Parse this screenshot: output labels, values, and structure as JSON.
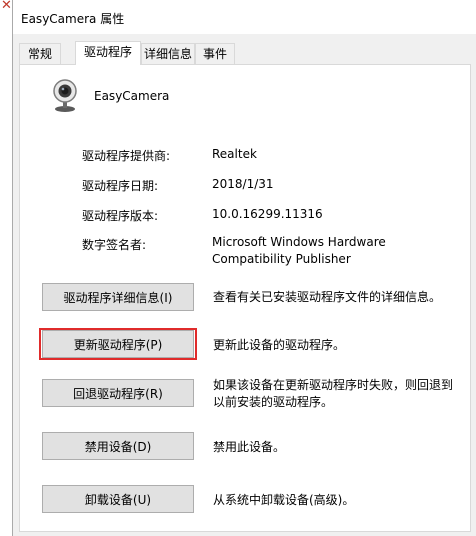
{
  "window": {
    "title": "EasyCamera 属性"
  },
  "tabs": [
    {
      "label": "常规"
    },
    {
      "label": "驱动程序"
    },
    {
      "label": "详细信息"
    },
    {
      "label": "事件"
    }
  ],
  "device": {
    "name": "EasyCamera",
    "icon": "webcam-icon"
  },
  "properties": {
    "provider_label": "驱动程序提供商:",
    "provider_value": "Realtek",
    "date_label": "驱动程序日期:",
    "date_value": "2018/1/31",
    "version_label": "驱动程序版本:",
    "version_value": "10.0.16299.11316",
    "signer_label": "数字签名者:",
    "signer_value": "Microsoft Windows Hardware Compatibility Publisher"
  },
  "actions": [
    {
      "button": "驱动程序详细信息(I)",
      "description": "查看有关已安装驱动程序文件的详细信息。"
    },
    {
      "button": "更新驱动程序(P)",
      "description": "更新此设备的驱动程序。"
    },
    {
      "button": "回退驱动程序(R)",
      "description": "如果该设备在更新驱动程序时失败，则回退到以前安装的驱动程序。"
    },
    {
      "button": "禁用设备(D)",
      "description": "禁用此设备。"
    },
    {
      "button": "卸载设备(U)",
      "description": "从系统中卸载设备(高级)。"
    }
  ],
  "colors": {
    "highlight_box": "#e02b2b",
    "panel_bg": "#ffffff",
    "dialog_bg": "#f0f0f0"
  }
}
